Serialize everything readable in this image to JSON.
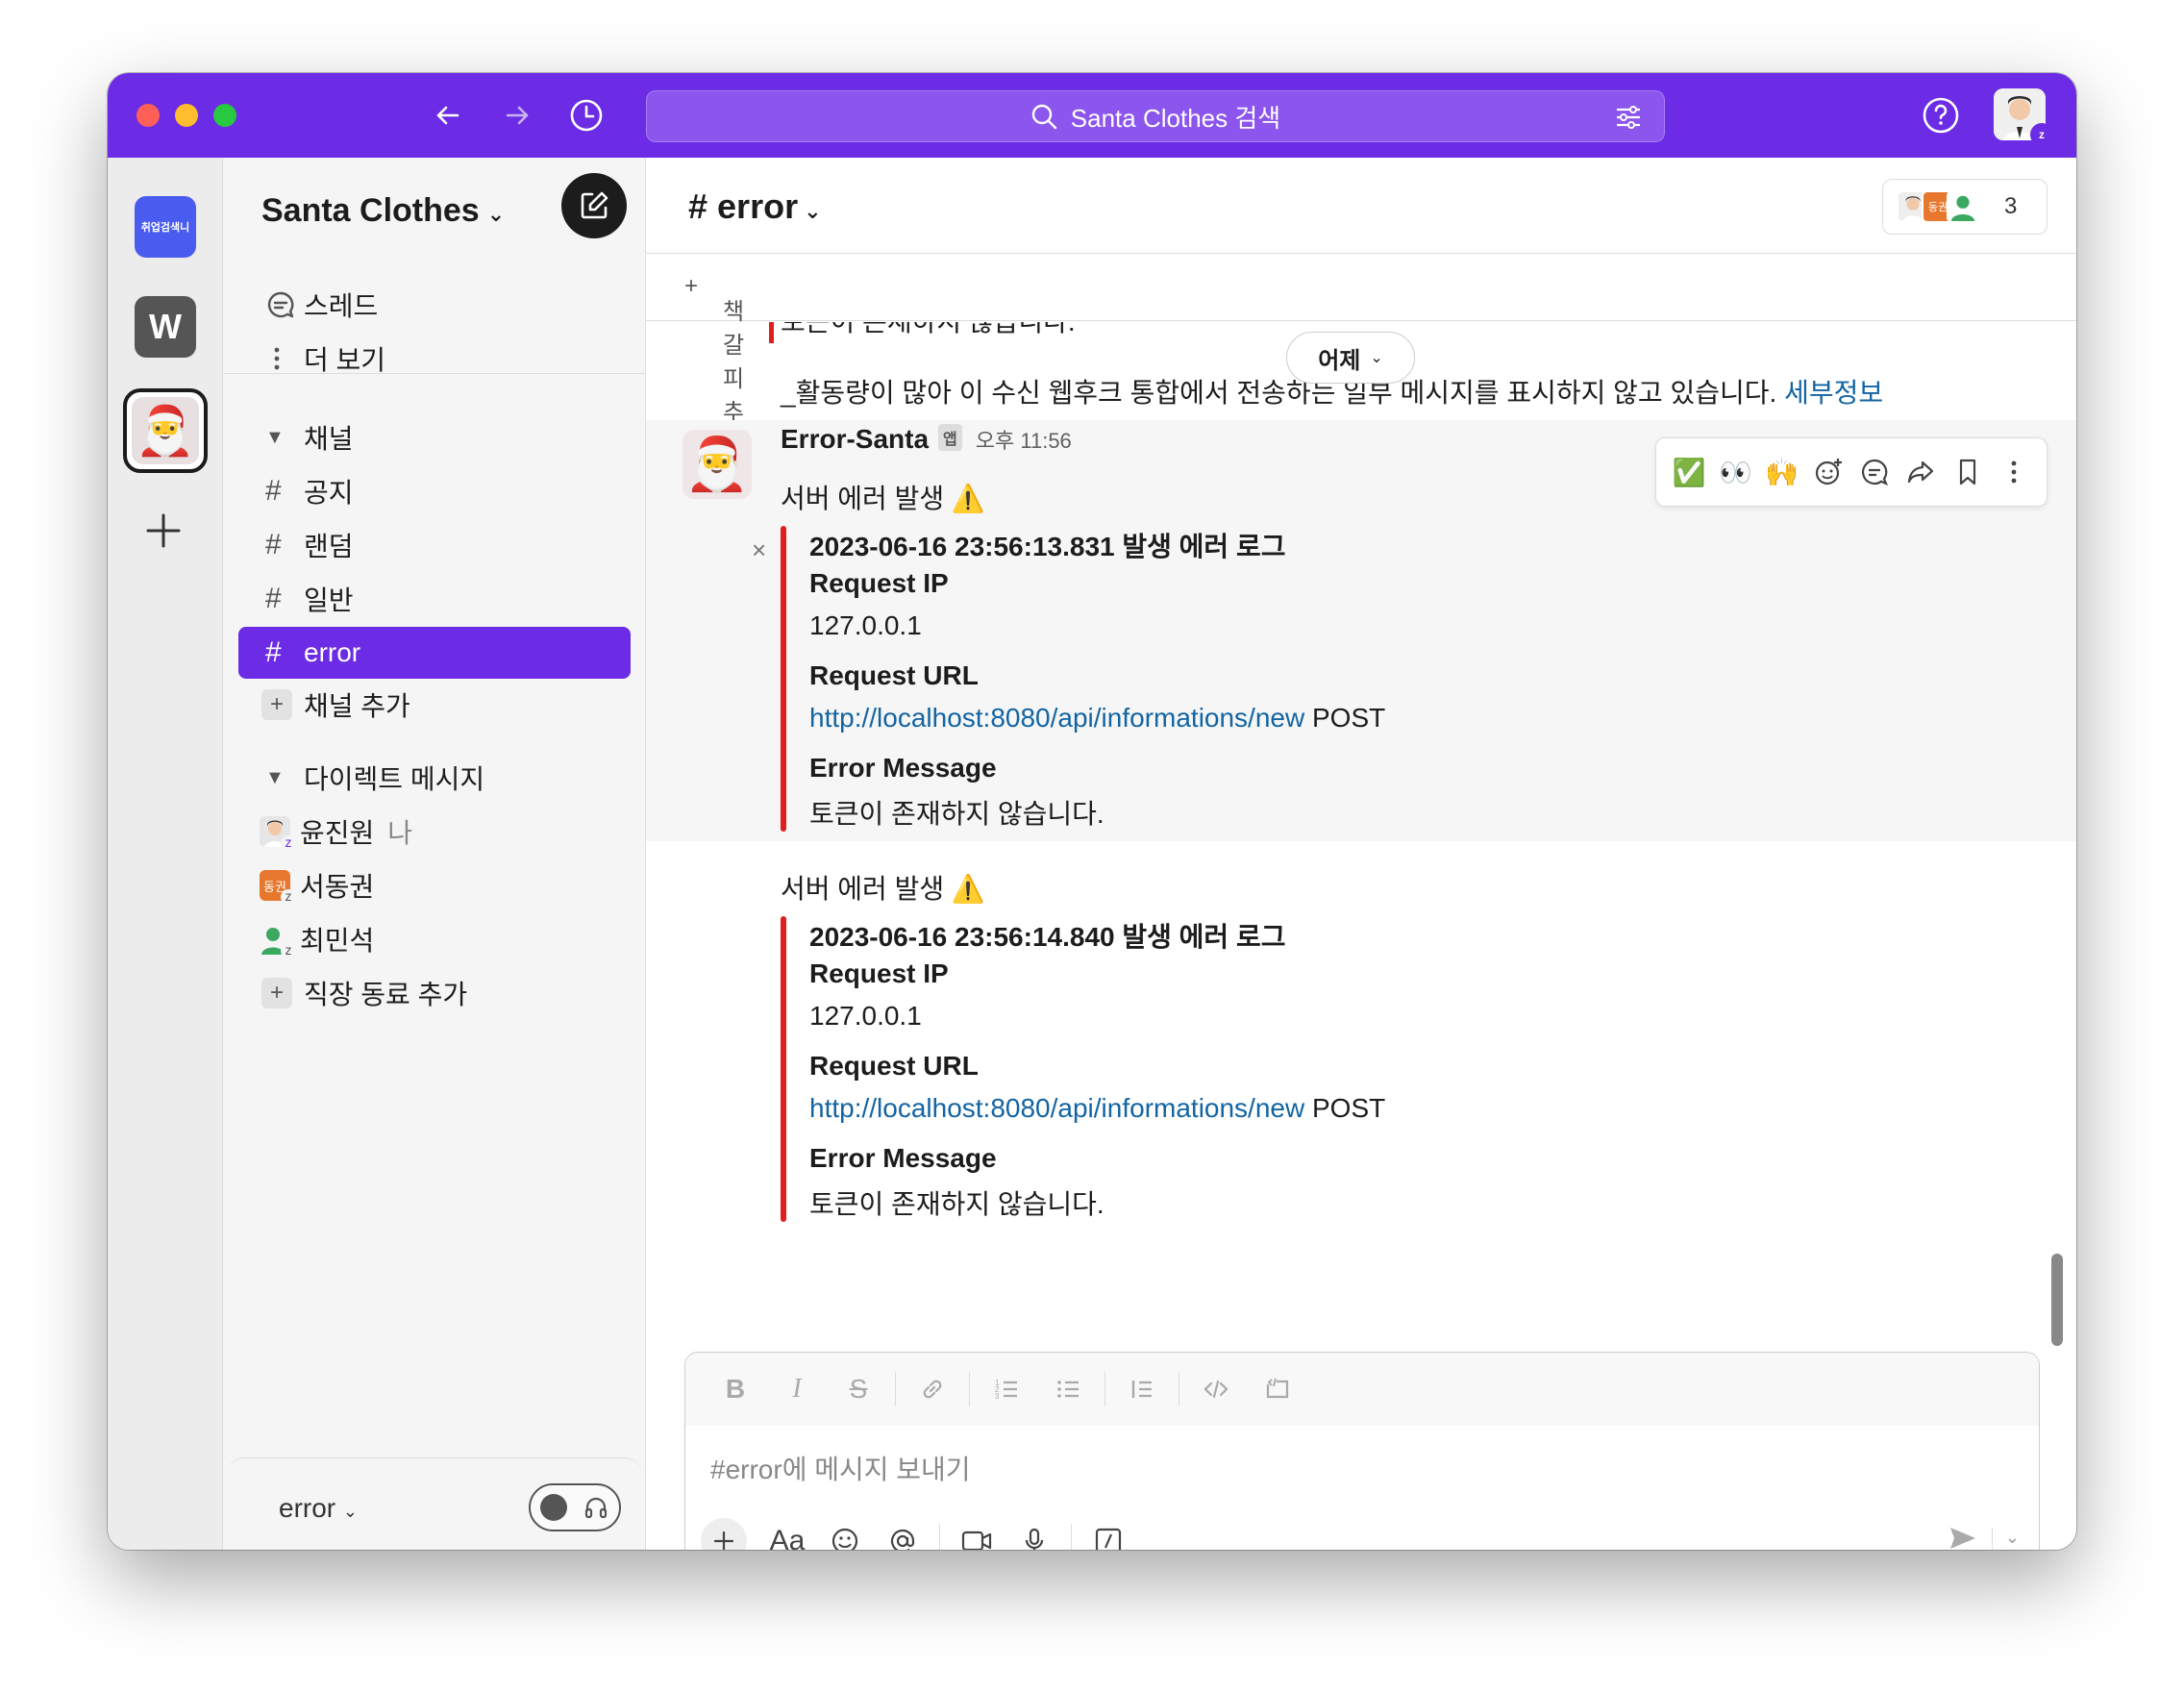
{
  "colors": {
    "accent": "#6c2be4",
    "error_bar": "#e01e1e",
    "link": "#1264a3"
  },
  "titlebar": {
    "search_text": "Santa Clothes 검색"
  },
  "rail": {
    "ws1_label": "취업검색니",
    "ws2_label": "W",
    "ws3_emoji": "🎅"
  },
  "sidebar": {
    "workspace_name": "Santa Clothes",
    "top_items": [
      {
        "label": "스레드",
        "icon": "threads-icon"
      },
      {
        "label": "더 보기",
        "icon": "more-vertical-icon"
      }
    ],
    "channels_header": "채널",
    "channels": [
      "공지",
      "랜덤",
      "일반",
      "error"
    ],
    "active_channel": "error",
    "add_channel": "채널 추가",
    "dm_header": "다이렉트 메시지",
    "dms": [
      {
        "name": "윤진원",
        "tag": "나",
        "avatar_color": "#d9d9d9",
        "avatar_text": ""
      },
      {
        "name": "서동권",
        "tag": "",
        "avatar_color": "#e8772e",
        "avatar_text": "동권"
      },
      {
        "name": "최민석",
        "tag": "",
        "avatar_color": "#3aa860",
        "avatar_text": ""
      }
    ],
    "add_coworker": "직장 동료 추가",
    "footer_channel": "error"
  },
  "channel": {
    "title": "error",
    "member_count": "3",
    "member_av2_text": "동권",
    "add_bookmark": "책갈피 추가",
    "date_divider": "어제"
  },
  "messages": {
    "prev_tail": "토큰이 존재하지 않습니다.",
    "truncate_note": "_활동량이 많아 이 수신 웹후크 통합에서 전송하는 일부 메시지를 표시하지 않고 있습니다. ",
    "truncate_link": "세부정보",
    "author": "Error-Santa",
    "app_tag": "앱",
    "time": "오후 11:56",
    "items": [
      {
        "text": "서버 에러 발생 ⚠️",
        "log_title": "2023-06-16 23:56:13.831 발생 에러 로그",
        "ip_label": "Request IP",
        "ip": "127.0.0.1",
        "url_label": "Request URL",
        "url": "http://localhost:8080/api/informations/new",
        "method": " POST",
        "err_label": "Error Message",
        "err": "토큰이 존재하지 않습니다."
      },
      {
        "text": "서버 에러 발생 ⚠️",
        "log_title": "2023-06-16 23:56:14.840 발생 에러 로그",
        "ip_label": "Request IP",
        "ip": "127.0.0.1",
        "url_label": "Request URL",
        "url": "http://localhost:8080/api/informations/new",
        "method": " POST",
        "err_label": "Error Message",
        "err": "토큰이 존재하지 않습니다."
      }
    ]
  },
  "actions": {
    "react1": "✅",
    "react2": "👀",
    "react3": "🙌"
  },
  "composer": {
    "placeholder": "#error에 메시지 보내기",
    "format_label": "Aa"
  }
}
